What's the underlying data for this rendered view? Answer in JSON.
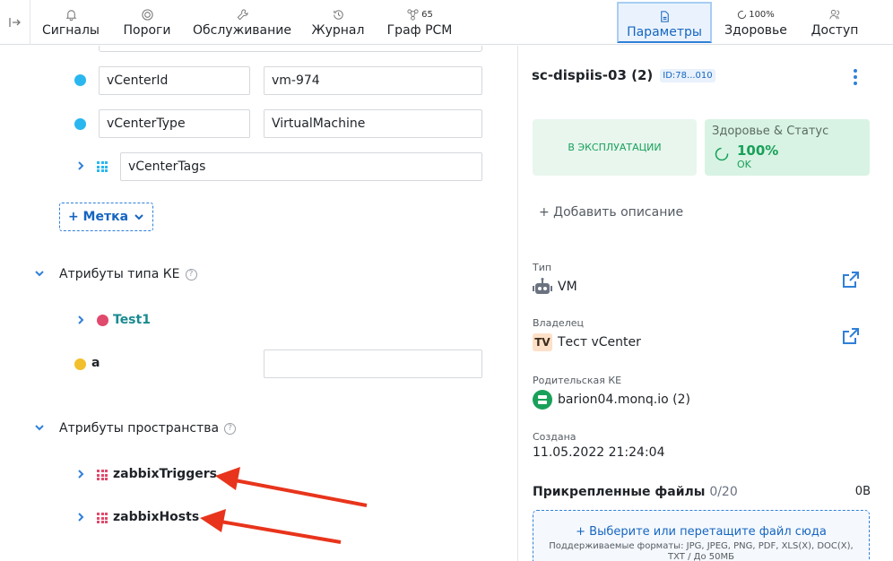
{
  "nav": {
    "items": [
      {
        "id": "signals",
        "label": "Сигналы",
        "icon": "bell-icon"
      },
      {
        "id": "thresholds",
        "label": "Пороги",
        "icon": "gauge-icon"
      },
      {
        "id": "maintenance",
        "label": "Обслуживание",
        "icon": "wrench-icon"
      },
      {
        "id": "journal",
        "label": "Журнал",
        "icon": "history-icon"
      },
      {
        "id": "graph",
        "label": "Граф РСМ",
        "icon": "graph-icon",
        "badge": "65"
      },
      {
        "id": "params",
        "label": "Параметры",
        "icon": "document-icon",
        "active": true
      },
      {
        "id": "health",
        "label": "Здоровье",
        "icon": "ring-icon",
        "badge": "100%"
      },
      {
        "id": "access",
        "label": "Доступ",
        "icon": "users-icon"
      }
    ]
  },
  "left": {
    "rows": [
      {
        "key": "vCenterId",
        "value": "vm-974"
      },
      {
        "key": "vCenterType",
        "value": "VirtualMachine"
      }
    ],
    "tags_key": "vCenterTags",
    "tag_button": "+ Метка",
    "sections": {
      "type_attrs": "Атрибуты типа КЕ",
      "space_attrs": "Атрибуты пространства"
    },
    "type_attrs": {
      "test1": "Test1",
      "a": "a",
      "a_value": ""
    },
    "space_attrs": {
      "triggers": "zabbixTriggers",
      "hosts": "zabbixHosts"
    }
  },
  "right": {
    "title": "sc-dispiis-03 (2)",
    "id_badge": "ID:78...010",
    "status": "В ЭКСПЛУАТАЦИИ",
    "health": {
      "title": "Здоровье & Статус",
      "value": "100%",
      "state": "OK"
    },
    "add_description": "+ Добавить описание",
    "type": {
      "label": "Тип",
      "value": "VM"
    },
    "owner": {
      "label": "Владелец",
      "initials": "TV",
      "value": "Тест vCenter"
    },
    "parent": {
      "label": "Родительская КЕ",
      "value": "barion04.monq.io (2)"
    },
    "created": {
      "label": "Создана",
      "value": "11.05.2022 21:24:04"
    },
    "files": {
      "title": "Прикрепленные файлы",
      "count": "0/20",
      "size": "0B",
      "dropzone_main": "+ Выберите или перетащите файл сюда",
      "dropzone_formats": "Поддерживаемые форматы: JPG, JPEG, PNG, PDF, XLS(X), DOC(X),",
      "dropzone_limit": "TXT / До 50МБ"
    }
  },
  "colors": {
    "accent": "#2f80d8",
    "cyan_dot": "#2ab7f0",
    "red_dot": "#e04a6c",
    "yellow_dot": "#f2c02c",
    "teal_text": "#1a8a90",
    "arrow": "#e8341c",
    "green": "#19a05a"
  }
}
